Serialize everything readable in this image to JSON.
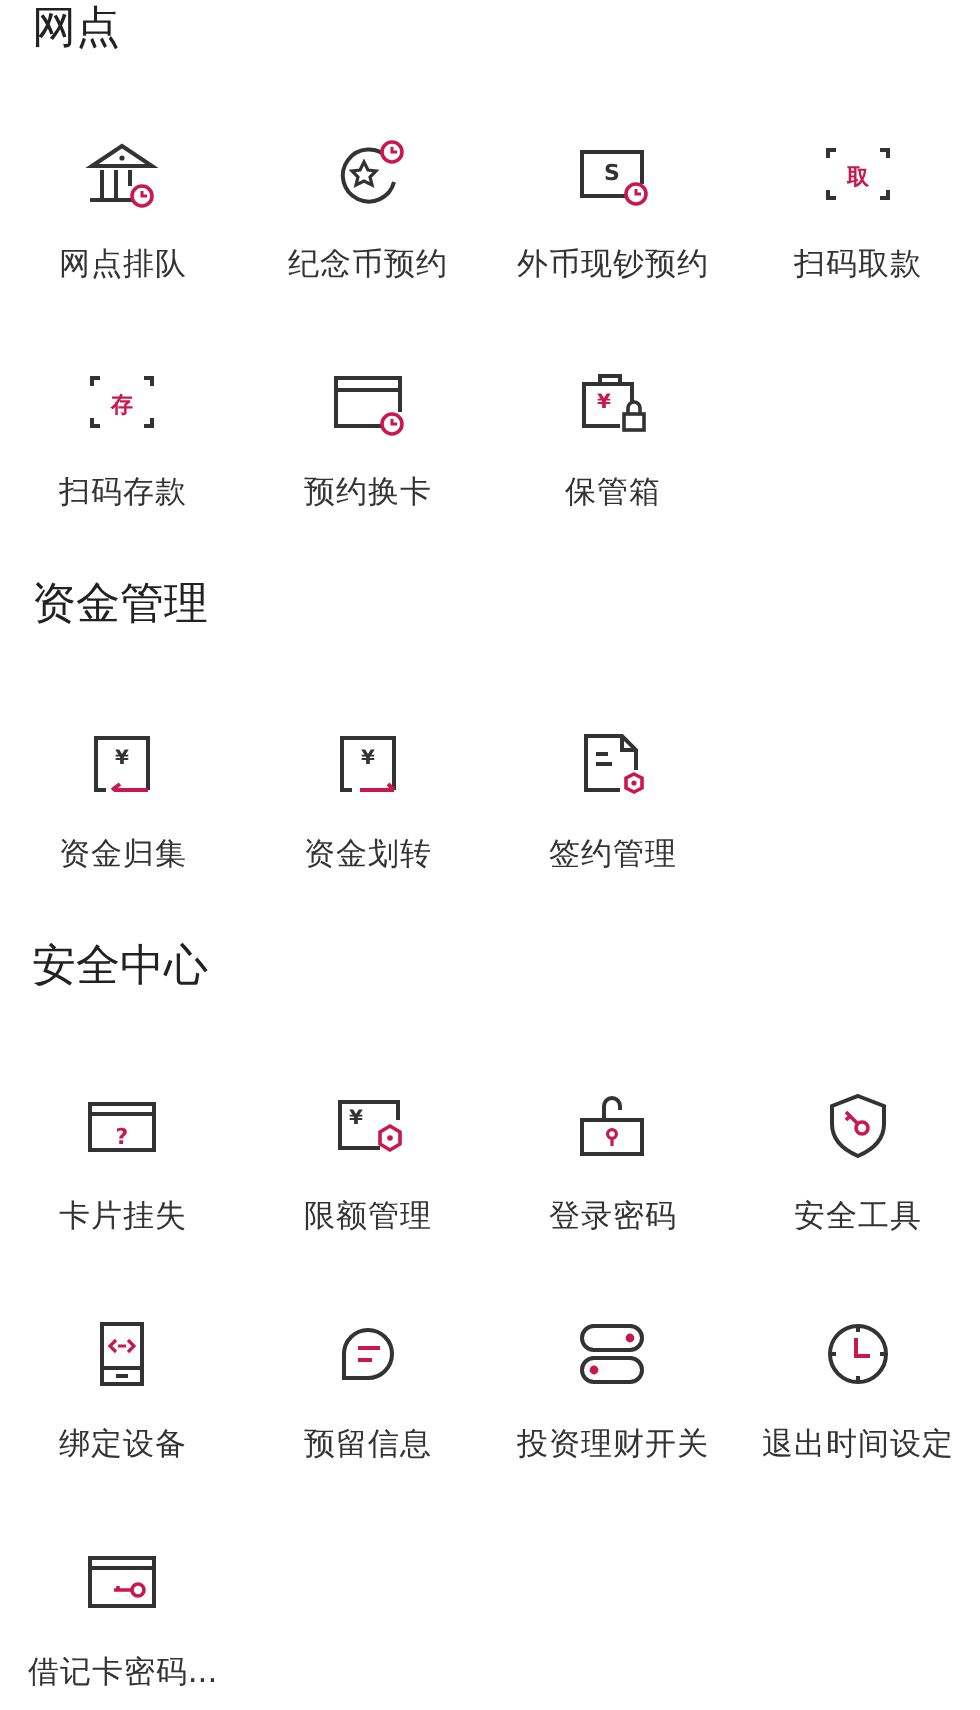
{
  "sections": [
    {
      "title": "网点",
      "items": [
        {
          "label": "网点排队",
          "kind": "bank"
        },
        {
          "label": "纪念币预约",
          "kind": "coin"
        },
        {
          "label": "外币现钞预约",
          "kind": "cash",
          "icon_text": "S"
        },
        {
          "label": "扫码取款",
          "kind": "scan",
          "icon_text": "取"
        },
        {
          "label": "扫码存款",
          "kind": "scan",
          "icon_text": "存"
        },
        {
          "label": "预约换卡",
          "kind": "cardclock"
        },
        {
          "label": "保管箱",
          "kind": "safe",
          "icon_text": "¥"
        }
      ]
    },
    {
      "title": "资金管理",
      "items": [
        {
          "label": "资金归集",
          "kind": "docin",
          "icon_text": "¥"
        },
        {
          "label": "资金划转",
          "kind": "docout",
          "icon_text": "¥"
        },
        {
          "label": "签约管理",
          "kind": "contract"
        }
      ]
    },
    {
      "title": "安全中心",
      "items": [
        {
          "label": "卡片挂失",
          "kind": "cardq",
          "icon_text": "?"
        },
        {
          "label": "限额管理",
          "kind": "limit",
          "icon_text": "¥"
        },
        {
          "label": "登录密码",
          "kind": "lock"
        },
        {
          "label": "安全工具",
          "kind": "shield"
        },
        {
          "label": "绑定设备",
          "kind": "phone"
        },
        {
          "label": "预留信息",
          "kind": "chat"
        },
        {
          "label": "投资理财开关",
          "kind": "toggles"
        },
        {
          "label": "退出时间设定",
          "kind": "clock"
        },
        {
          "label": "借记卡密码...",
          "kind": "cardkey"
        }
      ]
    }
  ]
}
